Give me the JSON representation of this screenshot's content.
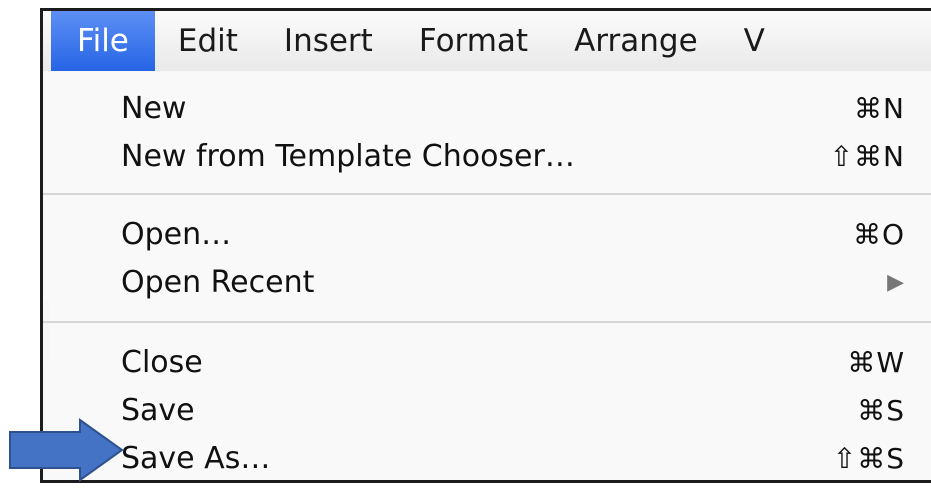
{
  "menubar": {
    "items": [
      {
        "label": "File",
        "active": true
      },
      {
        "label": "Edit"
      },
      {
        "label": "Insert"
      },
      {
        "label": "Format"
      },
      {
        "label": "Arrange"
      },
      {
        "label": "V"
      }
    ]
  },
  "file_menu": {
    "new": {
      "label": "New",
      "shortcut": "⌘N"
    },
    "new_template": {
      "label": "New from Template Chooser…",
      "shortcut": "⇧⌘N"
    },
    "open": {
      "label": "Open…",
      "shortcut": "⌘O"
    },
    "open_recent": {
      "label": "Open Recent",
      "submenu_indicator": "▶"
    },
    "close": {
      "label": "Close",
      "shortcut": "⌘W"
    },
    "save": {
      "label": "Save",
      "shortcut": "⌘S"
    },
    "save_as": {
      "label": "Save As…",
      "shortcut": "⇧⌘S"
    }
  },
  "colors": {
    "highlight": "#2b6ae8",
    "pointer_arrow": "#4472c4"
  },
  "annotation": {
    "icon": "pointer-arrow-icon"
  }
}
